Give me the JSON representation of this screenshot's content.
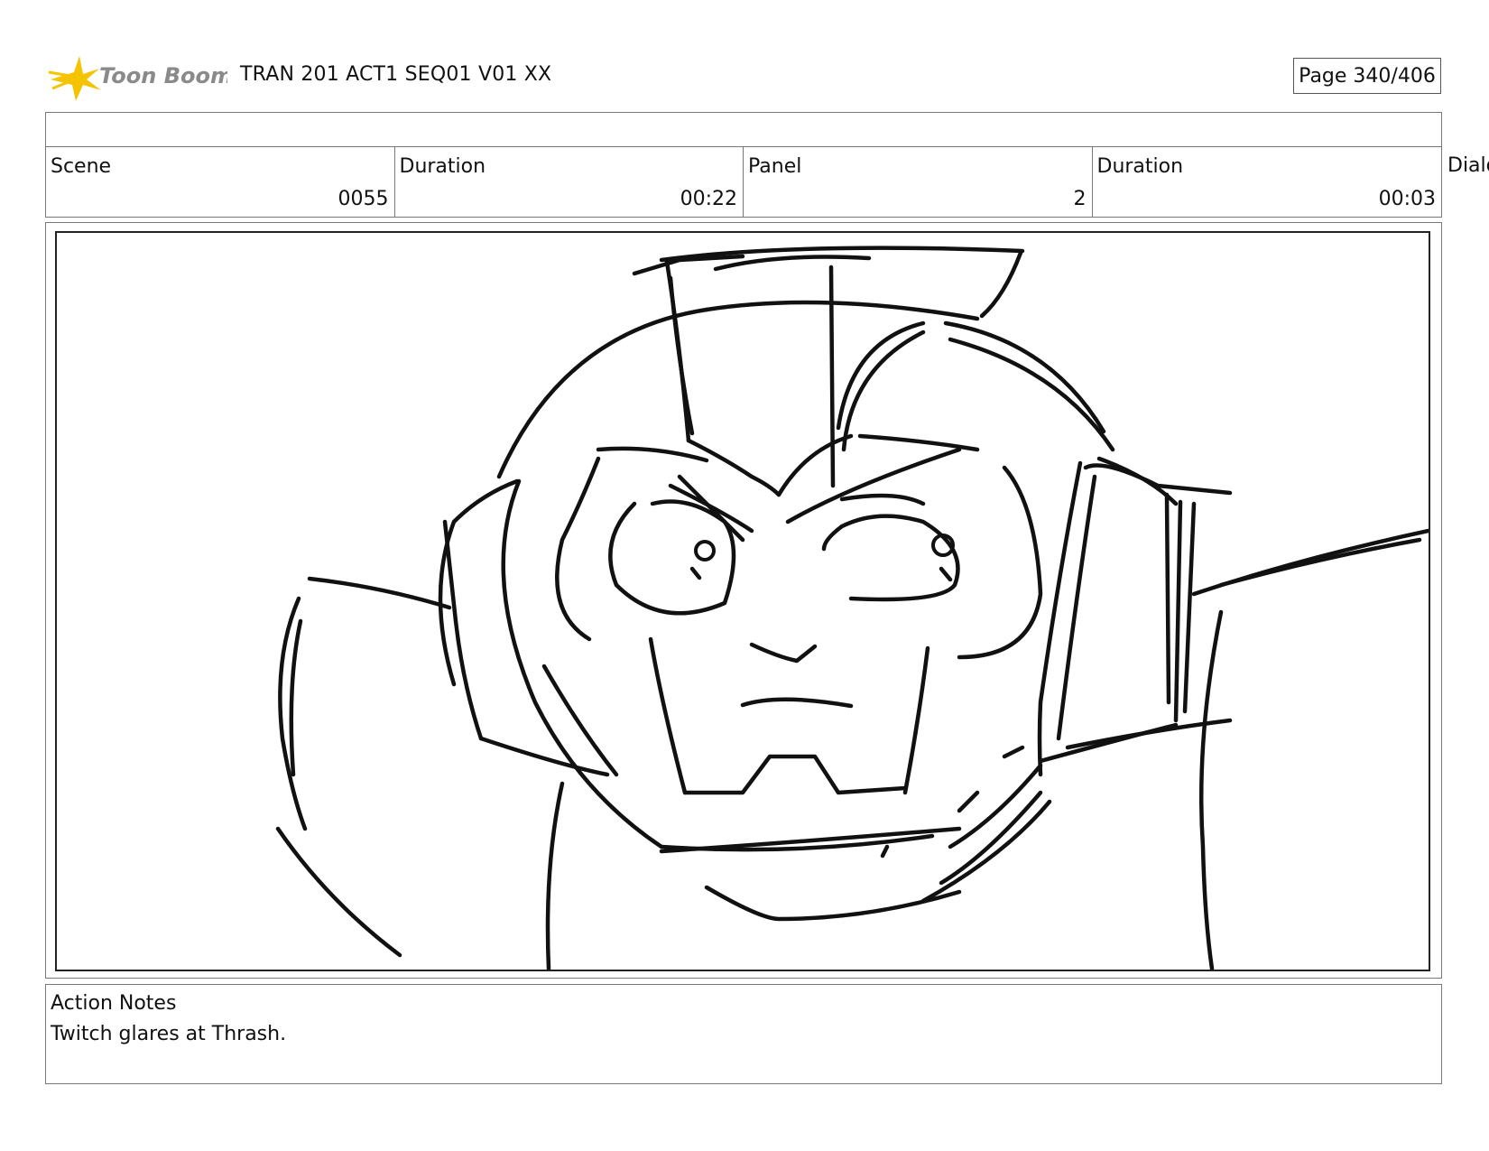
{
  "header": {
    "logo_text": "Toon Boom",
    "doc_title": "TRAN 201 ACT1 SEQ01 V01 XX",
    "page": "Page 340/406"
  },
  "info": {
    "scene_label": "Scene",
    "scene_value": "0055",
    "scene_duration_label": "Duration",
    "scene_duration_value": "00:22",
    "panel_label": "Panel",
    "panel_value": "2",
    "panel_duration_label": "Duration",
    "panel_duration_value": "00:03",
    "dialogue_label": "Dialo"
  },
  "notes": {
    "label": "Action Notes",
    "text": "Twitch glares at Thrash."
  },
  "colors": {
    "logo_star": "#f5c400",
    "logo_text": "#8a8a8a",
    "ink": "#111111",
    "border": "#777777"
  },
  "icons": {
    "logo": "toon-boom-star-icon"
  }
}
